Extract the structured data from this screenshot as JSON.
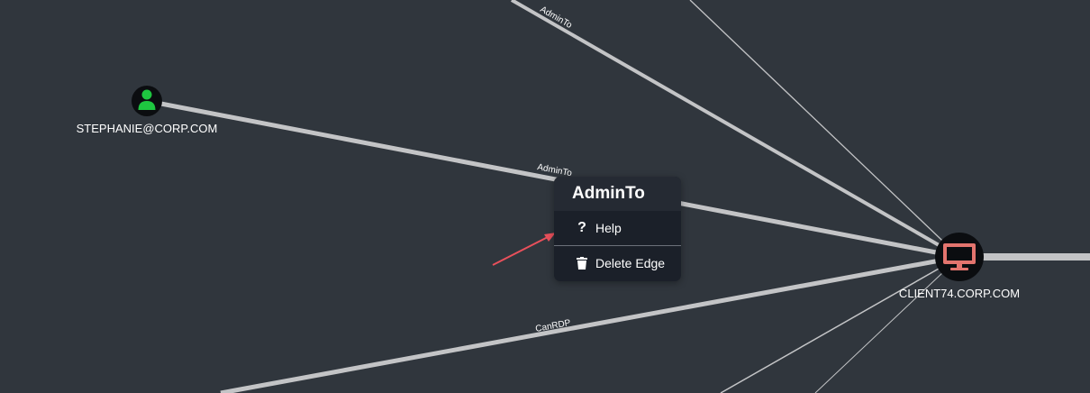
{
  "graph": {
    "nodes": {
      "user": {
        "label": "STEPHANIE@CORP.COM",
        "icon": "user-icon",
        "color": "#1ec640"
      },
      "computer": {
        "label": "CLIENT74.CORP.COM",
        "icon": "computer-icon",
        "color": "#e3746e"
      }
    },
    "edges": {
      "admin_to_top": "AdminTo",
      "admin_to_stephanie": "AdminTo",
      "can_rdp": "CanRDP"
    }
  },
  "context_menu": {
    "title": "AdminTo",
    "items": [
      {
        "label": "Help",
        "icon": "question-icon"
      },
      {
        "label": "Delete Edge",
        "icon": "trash-icon"
      }
    ]
  },
  "colors": {
    "background": "#30363d",
    "edge": "#c3c4c6",
    "menu_bg": "#1b2029",
    "menu_header": "#252a33",
    "annotation_arrow": "#e8505b"
  }
}
